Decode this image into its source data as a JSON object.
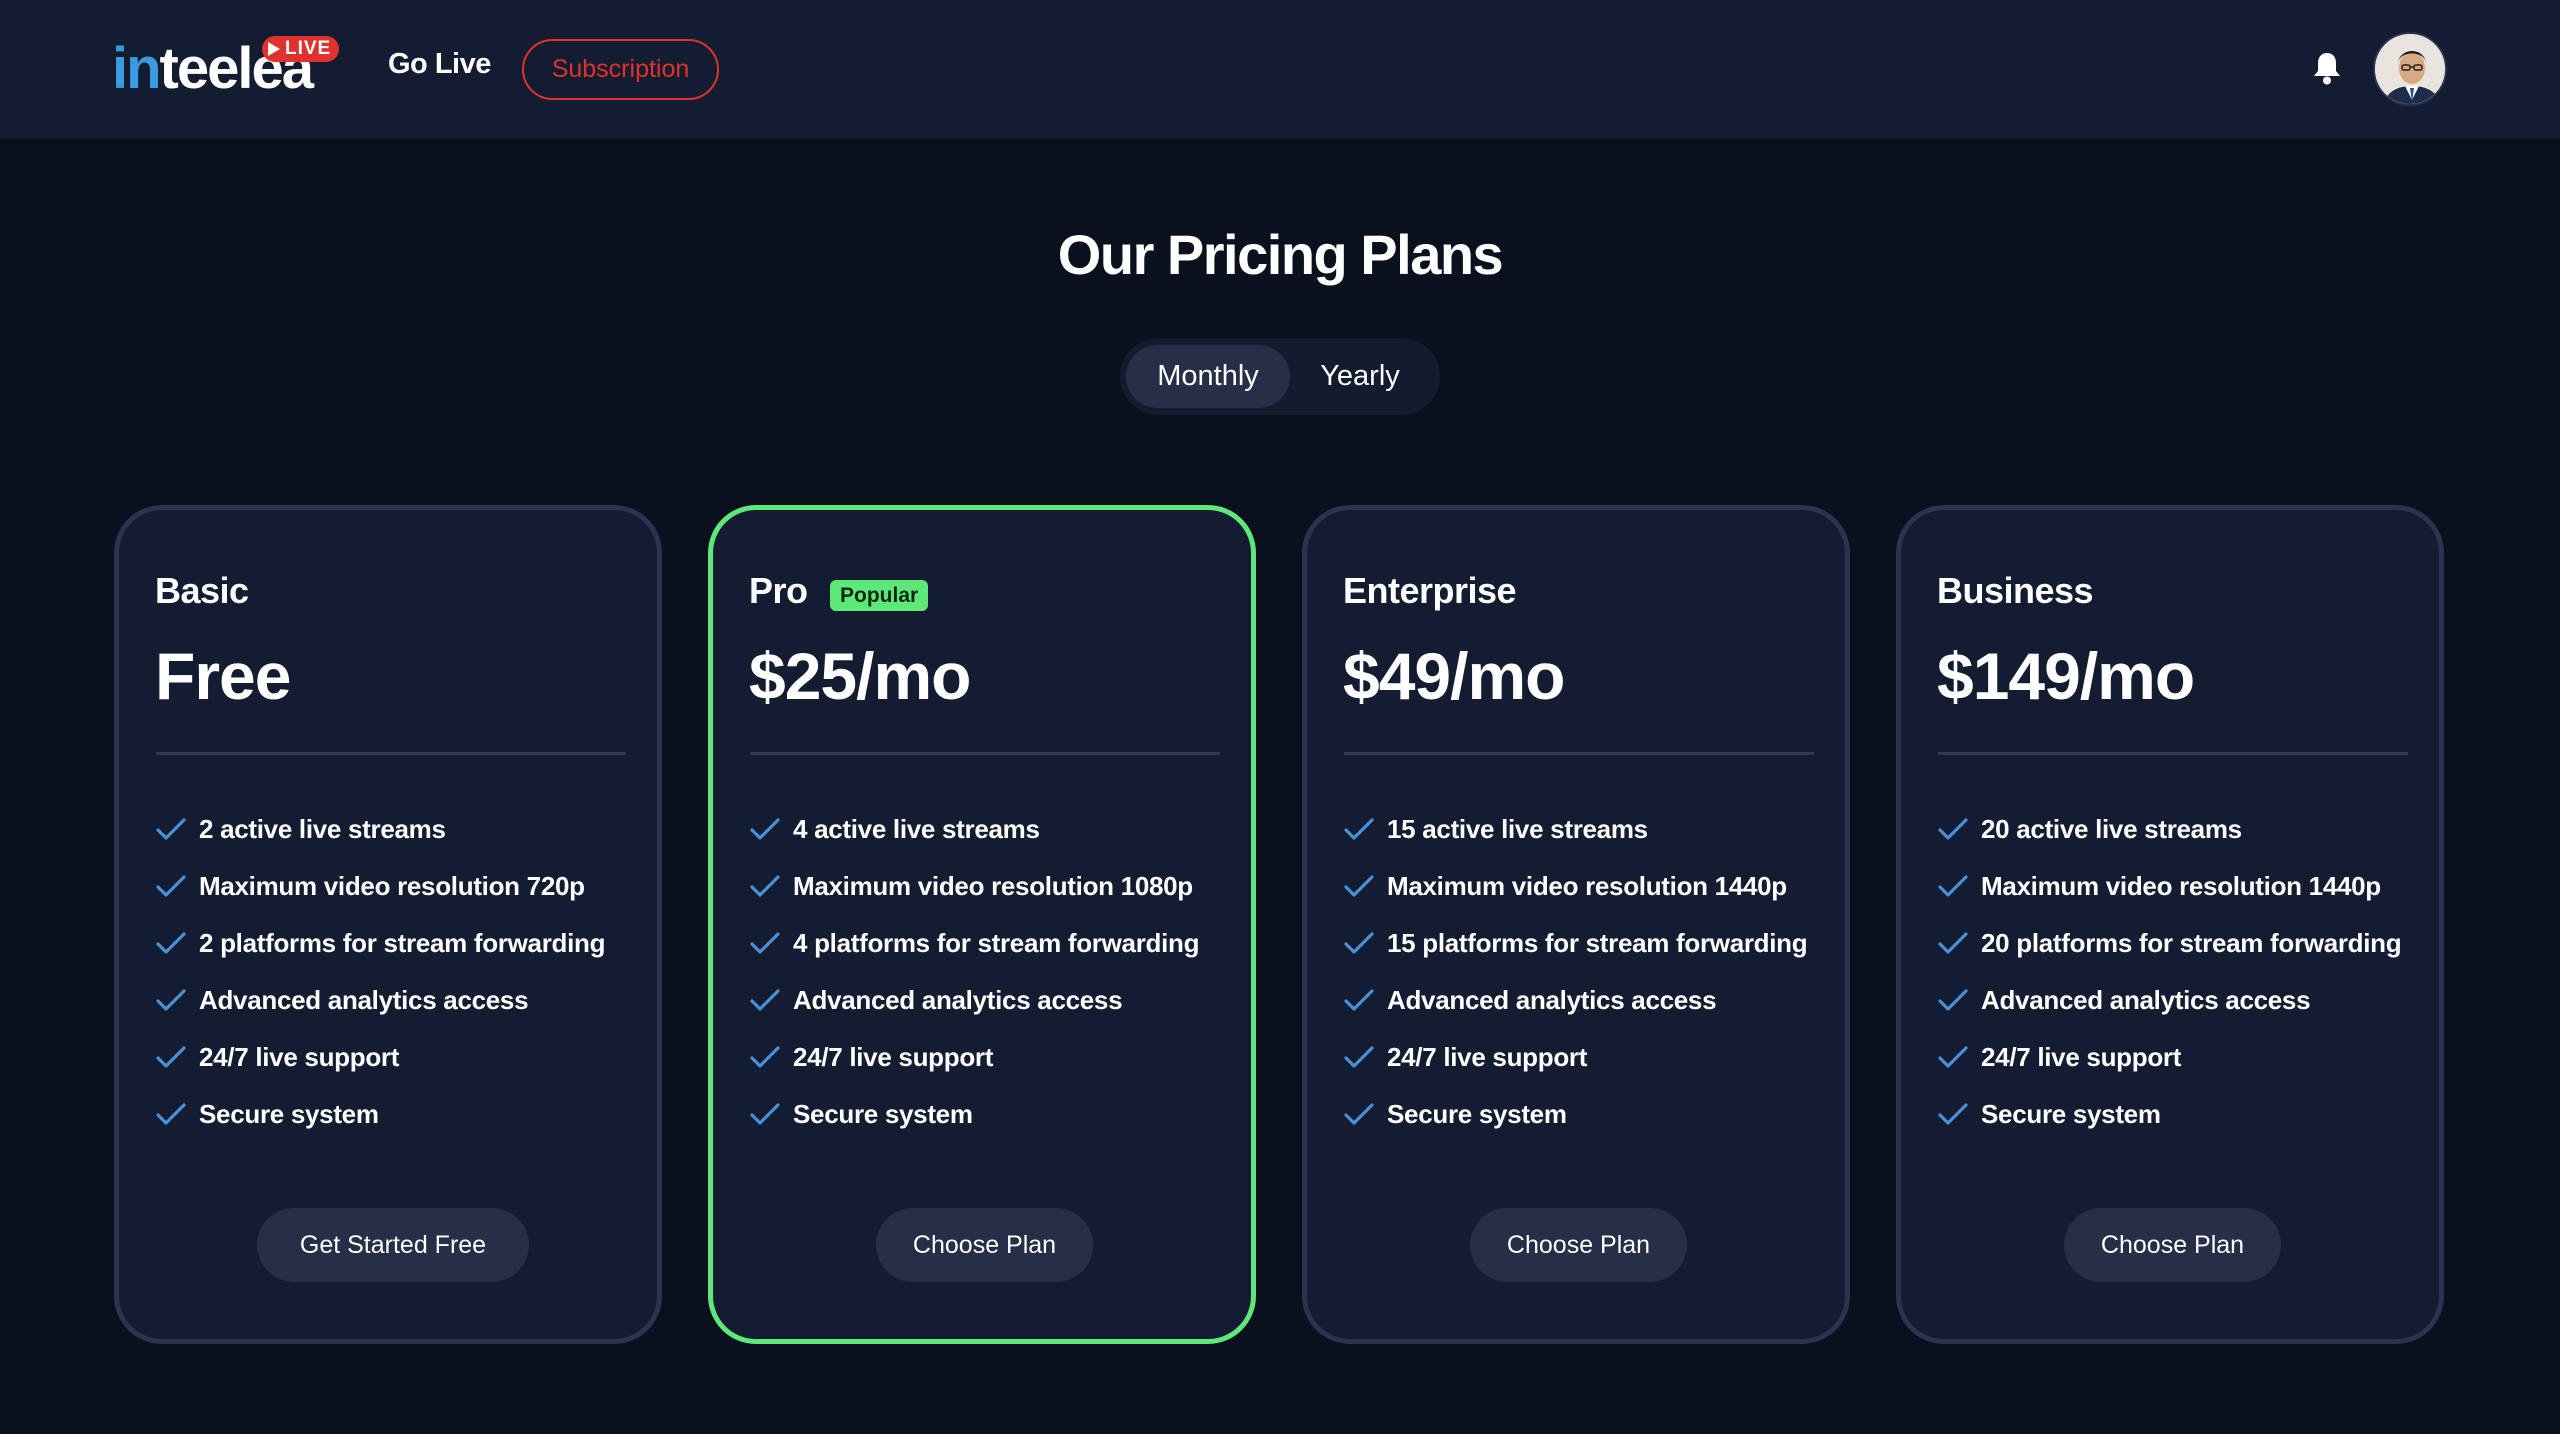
{
  "header": {
    "logo_text_accent": "in",
    "logo_text_rest": "teelea",
    "live_badge": "LIVE",
    "nav_golive": "Go Live",
    "nav_subscription": "Subscription"
  },
  "title": "Our Pricing Plans",
  "billing_toggle": {
    "monthly": "Monthly",
    "yearly": "Yearly",
    "selected": "Monthly"
  },
  "plans": [
    {
      "name": "Basic",
      "price": "Free",
      "features": [
        "2 active live streams",
        "Maximum video resolution 720p",
        "2 platforms for stream forwarding",
        "Advanced analytics access",
        "24/7 live support",
        "Secure system"
      ],
      "button": "Get Started Free"
    },
    {
      "name": "Pro",
      "badge": "Popular",
      "price": "$25/mo",
      "features": [
        "4 active live streams",
        "Maximum video resolution 1080p",
        "4 platforms for stream forwarding",
        "Advanced analytics access",
        "24/7 live support",
        "Secure system"
      ],
      "button": "Choose Plan"
    },
    {
      "name": "Enterprise",
      "price": "$49/mo",
      "features": [
        "15 active live streams",
        "Maximum video resolution 1440p",
        "15 platforms for stream forwarding",
        "Advanced analytics access",
        "24/7 live support",
        "Secure system"
      ],
      "button": "Choose Plan"
    },
    {
      "name": "Business",
      "price": "$149/mo",
      "features": [
        "20 active live streams",
        "Maximum video resolution 1440p",
        "20 platforms for stream forwarding",
        "Advanced analytics access",
        "24/7 live support",
        "Secure system"
      ],
      "button": "Choose Plan"
    }
  ],
  "colors": {
    "background": "#0a101d",
    "header": "#141c31",
    "card": "#141c31",
    "card_border": "#2a3350",
    "highlight": "#5ee87a",
    "accent_red": "#e0322c",
    "logo_blue": "#3b9ae1"
  },
  "icons": {
    "notification": "bell-icon",
    "feature_check": "check-icon",
    "live_play": "play-icon"
  }
}
